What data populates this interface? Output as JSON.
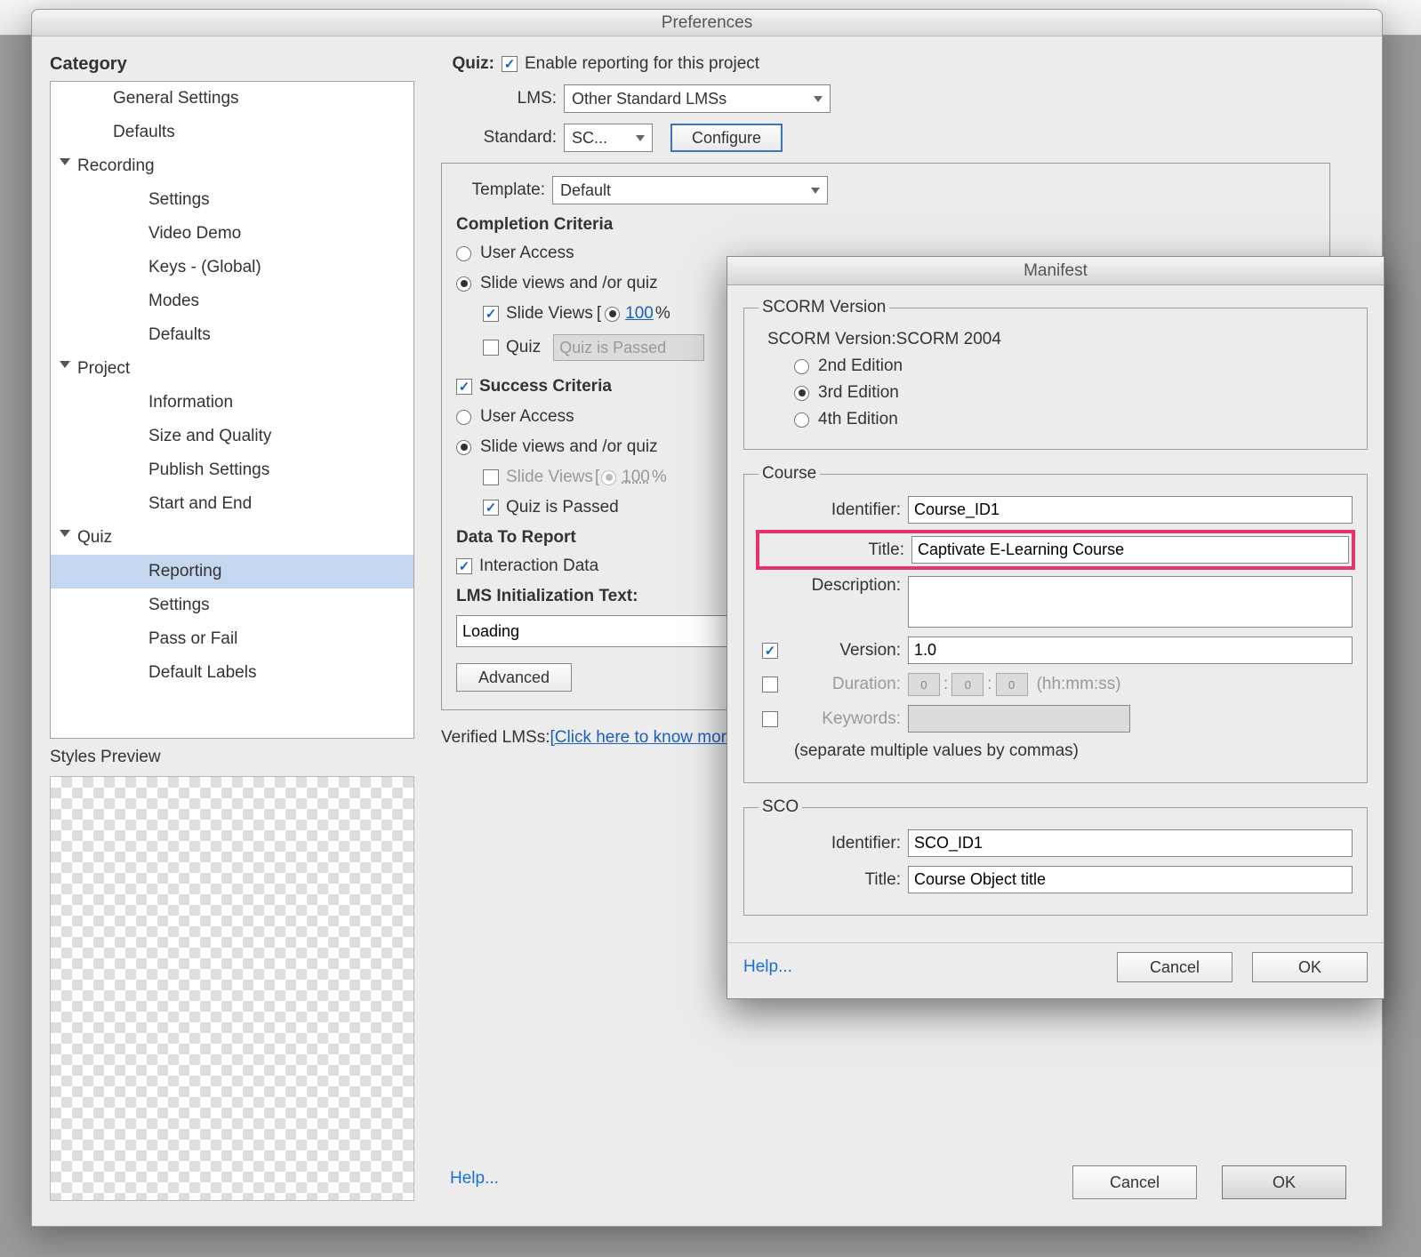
{
  "prefs": {
    "windowTitle": "Preferences",
    "categoryLabel": "Category",
    "tree": {
      "generalSettings": "General Settings",
      "defaults1": "Defaults",
      "recording": "Recording",
      "rec_settings": "Settings",
      "rec_videoDemo": "Video Demo",
      "rec_keys": "Keys - (Global)",
      "rec_modes": "Modes",
      "rec_defaults": "Defaults",
      "project": "Project",
      "proj_information": "Information",
      "proj_size": "Size and Quality",
      "proj_publish": "Publish Settings",
      "proj_startend": "Start and End",
      "quiz": "Quiz",
      "quiz_reporting": "Reporting",
      "quiz_settings": "Settings",
      "quiz_passfail": "Pass or Fail",
      "quiz_labels": "Default Labels"
    },
    "stylesPreview": "Styles Preview",
    "quizLabel": "Quiz:",
    "enableReporting": "Enable reporting for this project",
    "lmsLabel": "LMS:",
    "lmsValue": "Other Standard LMSs",
    "standardLabel": "Standard:",
    "standardValue": "SC...",
    "configureBtn": "Configure",
    "templateLabel": "Template:",
    "templateValue": "Default",
    "completionCriteria": "Completion Criteria",
    "userAccess": "User Access",
    "slideViewsQuiz": "Slide views and /or quiz",
    "slideViews": "Slide Views",
    "hundredPct": "100",
    "pct": "%",
    "quizCheckbox": "Quiz",
    "quizPassedPlaceholder": "Quiz is Passed",
    "successCriteria": "Success Criteria",
    "quizIsPassed": "Quiz is Passed",
    "dataToReport": "Data To Report",
    "interactionData": "Interaction Data",
    "lmsInit": "LMS Initialization Text:",
    "loading": "Loading",
    "advancedBtn": "Advanced",
    "verifiedLMSs": "Verified LMSs: ",
    "verifiedLink": "[Click here to know more]",
    "help": "Help...",
    "cancel": "Cancel",
    "ok": "OK"
  },
  "manifest": {
    "windowTitle": "Manifest",
    "scormVersionLegend": "SCORM Version",
    "scormVersionLabel": "SCORM Version:",
    "scormVersionValue": "SCORM 2004",
    "edition2": "2nd Edition",
    "edition3": "3rd Edition",
    "edition4": "4th Edition",
    "courseLegend": "Course",
    "identifier": "Identifier:",
    "identifierValue": "Course_ID1",
    "title": "Title:",
    "titleValue": "Captivate E-Learning Course",
    "description": "Description:",
    "version": "Version:",
    "versionValue": "1.0",
    "duration": "Duration:",
    "durZero": "0",
    "durFormat": "(hh:mm:ss)",
    "keywords": "Keywords:",
    "keywordsHint": "(separate multiple values by commas)",
    "scoLegend": "SCO",
    "scoIdentifierValue": "SCO_ID1",
    "scoTitleValue": "Course Object title",
    "help": "Help...",
    "cancel": "Cancel",
    "ok": "OK"
  }
}
